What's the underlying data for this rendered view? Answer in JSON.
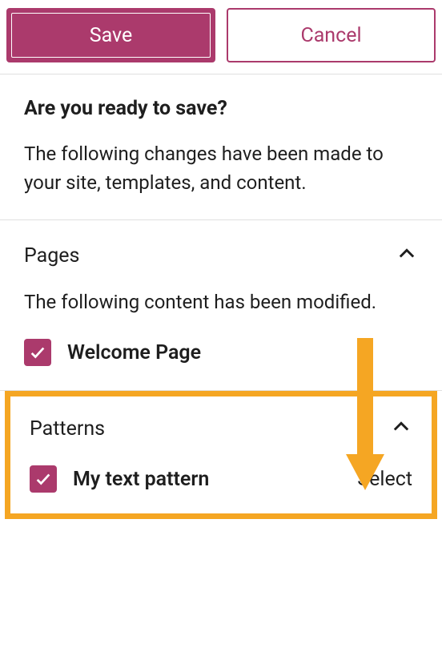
{
  "buttons": {
    "save_label": "Save",
    "cancel_label": "Cancel"
  },
  "intro": {
    "title": "Are you ready to save?",
    "text": "The following changes have been made to your site, templates, and content."
  },
  "pages_section": {
    "title": "Pages",
    "description": "The following content has been modified.",
    "items": [
      {
        "label": "Welcome Page"
      }
    ]
  },
  "patterns_section": {
    "title": "Patterns",
    "items": [
      {
        "label": "My text pattern",
        "action": "Select"
      }
    ]
  }
}
